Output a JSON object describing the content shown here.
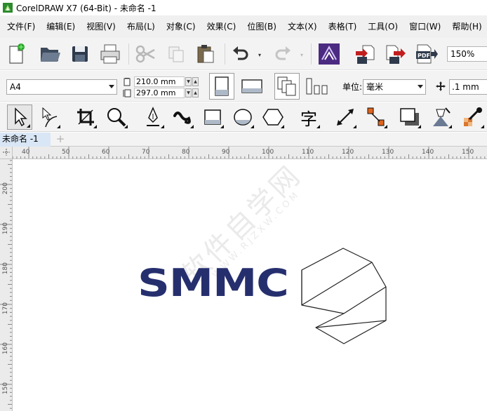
{
  "window": {
    "title": "CorelDRAW X7 (64-Bit) - 未命名 -1"
  },
  "menu": [
    {
      "label": "文件(F)"
    },
    {
      "label": "编辑(E)"
    },
    {
      "label": "视图(V)"
    },
    {
      "label": "布局(L)"
    },
    {
      "label": "对象(C)"
    },
    {
      "label": "效果(C)"
    },
    {
      "label": "位图(B)"
    },
    {
      "label": "文本(X)"
    },
    {
      "label": "表格(T)"
    },
    {
      "label": "工具(O)"
    },
    {
      "label": "窗口(W)"
    },
    {
      "label": "帮助(H)"
    }
  ],
  "standard_toolbar": {
    "zoom": "150%",
    "icons": [
      "new-document-icon",
      "open-folder-icon",
      "save-icon",
      "print-icon",
      "cut-icon",
      "copy-icon",
      "paste-icon",
      "undo-icon",
      "redo-icon",
      "corel-connect-icon",
      "import-icon",
      "export-icon",
      "export-pdf-icon"
    ]
  },
  "property_bar": {
    "page_size": "A4",
    "width": "210.0 mm",
    "height": "297.0 mm",
    "unit_label": "单位:",
    "unit_value": "毫米",
    "nudge": ".1 mm"
  },
  "toolbox": {
    "tools": [
      "pick-tool-icon",
      "shape-tool-icon",
      "crop-tool-icon",
      "zoom-tool-icon",
      "pen-tool-icon",
      "artistic-media-icon",
      "rectangle-tool-icon",
      "ellipse-tool-icon",
      "polygon-tool-icon",
      "text-tool-icon",
      "dimension-tool-icon",
      "connector-tool-icon",
      "drop-shadow-icon",
      "transparency-tool-icon",
      "eyedropper-tool-icon"
    ],
    "text_tool_glyph": "字"
  },
  "document": {
    "tab_label": "未命名 -1",
    "add_tab_glyph": "+"
  },
  "rulers": {
    "horizontal": [
      "40",
      "50",
      "60",
      "70",
      "80",
      "90",
      "100",
      "110",
      "120",
      "130",
      "140",
      "150"
    ],
    "vertical": [
      "200",
      "190",
      "180",
      "170",
      "160",
      "150"
    ]
  },
  "canvas": {
    "logo_text": "SMMC",
    "logo_color": "#262f6e",
    "watermark_main": "软件自学网",
    "watermark_sub": "WWW.RJZXW.COM"
  },
  "colors": {
    "toolbar_bg": "#f3f3f3",
    "menubar_bg": "#f0f0f0",
    "tab_active_bg": "#d9e6f5",
    "ruler_bg": "#ebebeb"
  }
}
